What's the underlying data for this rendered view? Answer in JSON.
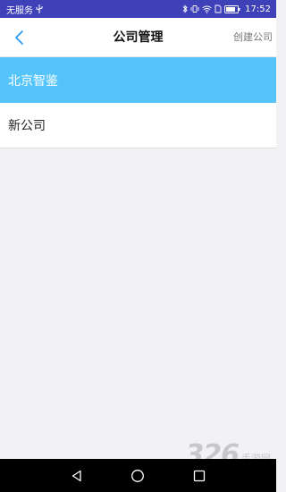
{
  "status_bar": {
    "carrier": "无服务",
    "battery": "",
    "time": "17:52",
    "icons": [
      "usb-icon",
      "bluetooth-icon",
      "vibrate-icon",
      "wifi-icon",
      "sim-icon",
      "battery-icon"
    ]
  },
  "header": {
    "title": "公司管理",
    "create_label": "创建公司",
    "back_icon": "chevron-left-icon"
  },
  "companies": [
    {
      "name": "北京智鉴",
      "selected": true
    },
    {
      "name": "新公司",
      "selected": false
    }
  ],
  "colors": {
    "status_bar": "#3f41b8",
    "selected_row": "#55c4fa",
    "back_icon": "#2196f3",
    "background": "#f2f2f4"
  },
  "nav_bar": {
    "buttons": [
      "back-triangle-icon",
      "home-circle-icon",
      "recents-square-icon"
    ]
  },
  "watermark": {
    "big": "326",
    "small": "手游网"
  }
}
